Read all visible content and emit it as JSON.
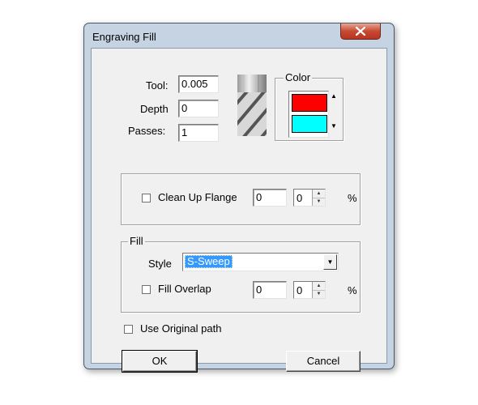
{
  "window": {
    "title": "Engraving Fill"
  },
  "tool_params": {
    "tool_label": "Tool:",
    "tool_value": "0.005",
    "depth_label": "Depth",
    "depth_value": "0",
    "passes_label": "Passes:",
    "passes_value": "1"
  },
  "color_group": {
    "title": "Color",
    "primary_color": "#ff0000",
    "secondary_color": "#00ffff"
  },
  "cleanup": {
    "label": "Clean Up Flange",
    "checked": false,
    "value": "0",
    "spin_value": "0",
    "unit": "%"
  },
  "fill_group": {
    "title": "Fill",
    "style_label": "Style",
    "style_value": "S-Sweep",
    "overlap_label": "Fill Overlap",
    "overlap_checked": false,
    "overlap_value": "0",
    "overlap_spin_value": "0",
    "unit": "%"
  },
  "use_original": {
    "label": "Use Original path",
    "checked": false
  },
  "buttons": {
    "ok": "OK",
    "cancel": "Cancel"
  }
}
